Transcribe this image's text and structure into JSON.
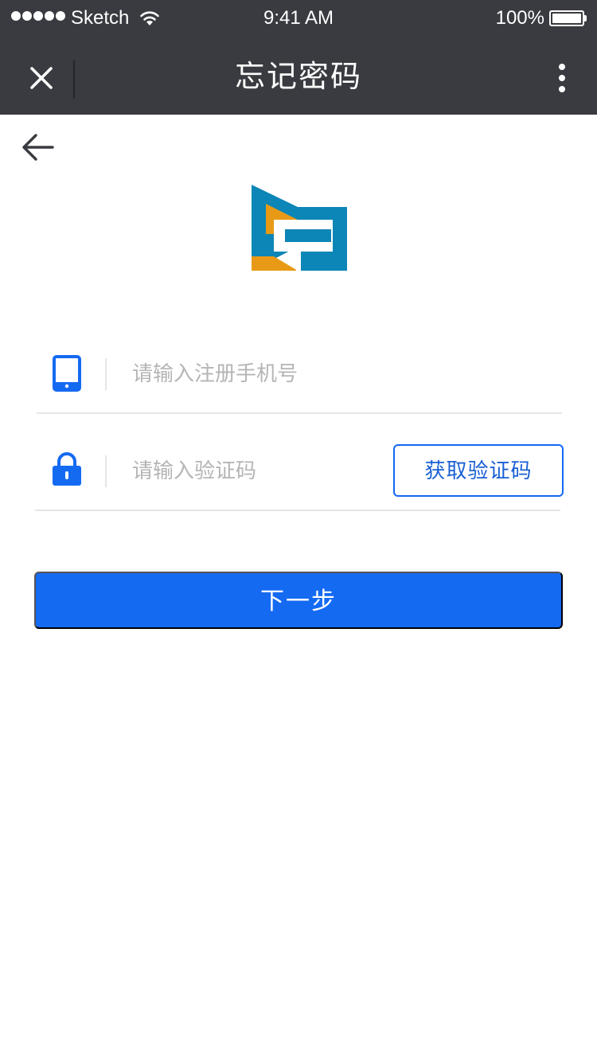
{
  "status_bar": {
    "carrier": "Sketch",
    "time": "9:41 AM",
    "battery": "100%"
  },
  "nav": {
    "title": "忘记密码"
  },
  "form": {
    "phone_placeholder": "请输入注册手机号",
    "phone_value": "",
    "code_placeholder": "请输入验证码",
    "code_value": "",
    "get_code_label": "获取验证码",
    "next_label": "下一步"
  },
  "icons": {
    "close": "close-icon",
    "more": "more-vertical-icon",
    "back": "arrow-left-icon",
    "phone": "tablet-icon",
    "lock": "lock-icon"
  },
  "colors": {
    "bar_bg": "#393b40",
    "accent": "#156af2",
    "logo_blue": "#0b86b6",
    "logo_orange": "#e89a16"
  }
}
